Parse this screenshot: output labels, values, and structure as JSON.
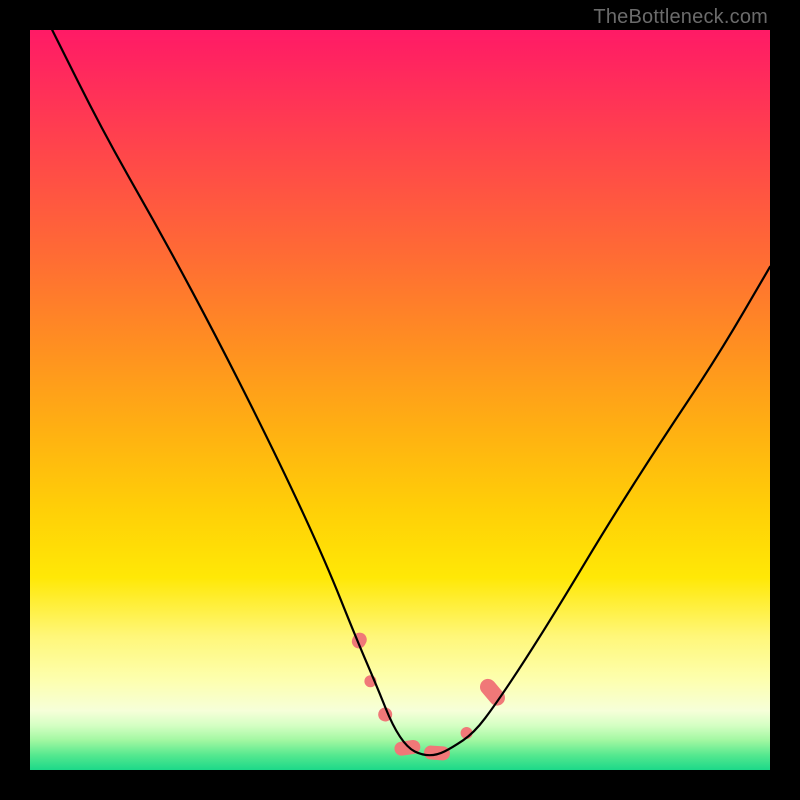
{
  "attribution": "TheBottleneck.com",
  "chart_data": {
    "type": "line",
    "title": "",
    "xlabel": "",
    "ylabel": "",
    "xlim": [
      0,
      100
    ],
    "ylim": [
      0,
      100
    ],
    "series": [
      {
        "name": "bottleneck-curve",
        "x": [
          3,
          10,
          18,
          26,
          34,
          40,
          44,
          47,
          49,
          51,
          53,
          55,
          57,
          60,
          63,
          67,
          72,
          78,
          85,
          93,
          100
        ],
        "values": [
          100,
          86,
          72,
          57,
          41,
          28,
          18,
          11,
          6,
          3,
          2,
          2,
          3,
          5,
          9,
          15,
          23,
          33,
          44,
          56,
          68
        ]
      }
    ],
    "green_band_y_range": [
      0,
      6
    ],
    "markers": {
      "name": "highlight-beads",
      "color": "#f07878",
      "points": [
        {
          "x": 44.5,
          "y": 17.5,
          "shape": "capsule",
          "r": 7,
          "len": 16,
          "angle": -62
        },
        {
          "x": 46.0,
          "y": 12.0,
          "shape": "dot",
          "r": 6
        },
        {
          "x": 48.0,
          "y": 7.5,
          "shape": "capsule",
          "r": 7,
          "len": 14,
          "angle": -58
        },
        {
          "x": 51.0,
          "y": 3.0,
          "shape": "capsule",
          "r": 7,
          "len": 26,
          "angle": -8
        },
        {
          "x": 55.0,
          "y": 2.3,
          "shape": "capsule",
          "r": 7,
          "len": 26,
          "angle": 4
        },
        {
          "x": 59.0,
          "y": 5.0,
          "shape": "dot",
          "r": 6
        },
        {
          "x": 62.5,
          "y": 10.5,
          "shape": "capsule",
          "r": 8,
          "len": 30,
          "angle": 50
        }
      ]
    }
  }
}
